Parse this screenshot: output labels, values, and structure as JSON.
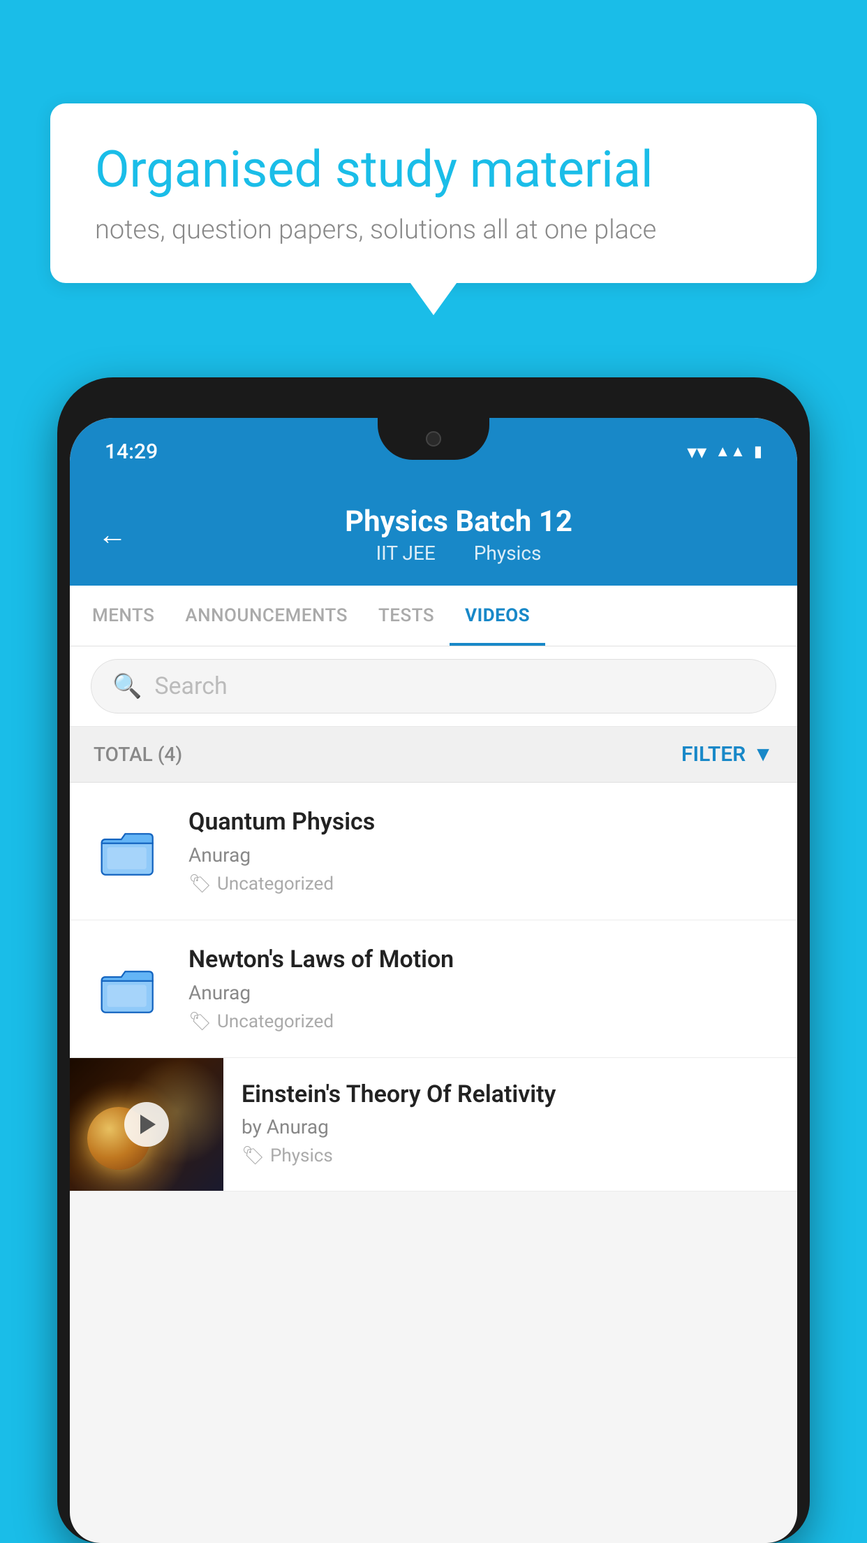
{
  "background_color": "#1ABDE8",
  "speech_bubble": {
    "title": "Organised study material",
    "subtitle": "notes, question papers, solutions all at one place"
  },
  "status_bar": {
    "time": "14:29",
    "icons": [
      "wifi",
      "signal",
      "battery"
    ]
  },
  "app_header": {
    "back_label": "←",
    "title": "Physics Batch 12",
    "subtitle_part1": "IIT JEE",
    "subtitle_part2": "Physics"
  },
  "tabs": [
    {
      "label": "MENTS",
      "active": false
    },
    {
      "label": "ANNOUNCEMENTS",
      "active": false
    },
    {
      "label": "TESTS",
      "active": false
    },
    {
      "label": "VIDEOS",
      "active": true
    }
  ],
  "search": {
    "placeholder": "Search"
  },
  "filter_bar": {
    "total_label": "TOTAL (4)",
    "filter_label": "FILTER"
  },
  "video_items": [
    {
      "title": "Quantum Physics",
      "author": "Anurag",
      "tag": "Uncategorized",
      "has_thumbnail": false
    },
    {
      "title": "Newton's Laws of Motion",
      "author": "Anurag",
      "tag": "Uncategorized",
      "has_thumbnail": false
    },
    {
      "title": "Einstein's Theory Of Relativity",
      "author": "by Anurag",
      "tag": "Physics",
      "has_thumbnail": true
    }
  ]
}
